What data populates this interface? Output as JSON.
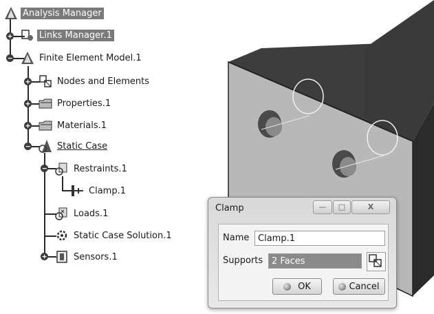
{
  "tree": {
    "items": [
      {
        "label": "Analysis Manager",
        "icon": "analysis-manager-icon"
      },
      {
        "label": "Links Manager.1",
        "icon": "links-manager-icon"
      },
      {
        "label": "Finite Element Model.1",
        "icon": "finite-element-model-icon"
      },
      {
        "label": "Nodes and Elements",
        "icon": "nodes-elements-icon"
      },
      {
        "label": "Properties.1",
        "icon": "folder-icon"
      },
      {
        "label": "Materials.1",
        "icon": "folder-icon"
      },
      {
        "label": "Static Case",
        "icon": "static-case-icon"
      },
      {
        "label": "Restraints.1",
        "icon": "restraints-icon"
      },
      {
        "label": "Clamp.1",
        "icon": "clamp-icon"
      },
      {
        "label": "Loads.1",
        "icon": "loads-icon"
      },
      {
        "label": "Static Case Solution.1",
        "icon": "solution-icon"
      },
      {
        "label": "Sensors.1",
        "icon": "sensors-icon"
      }
    ]
  },
  "dialog": {
    "title": "Clamp",
    "minimize": "—",
    "maximize": "□",
    "close": "X",
    "name_label": "Name",
    "name_value": "Clamp.1",
    "supports_label": "Supports",
    "supports_value": "2 Faces",
    "ok_label": "OK",
    "cancel_label": "Cancel"
  }
}
